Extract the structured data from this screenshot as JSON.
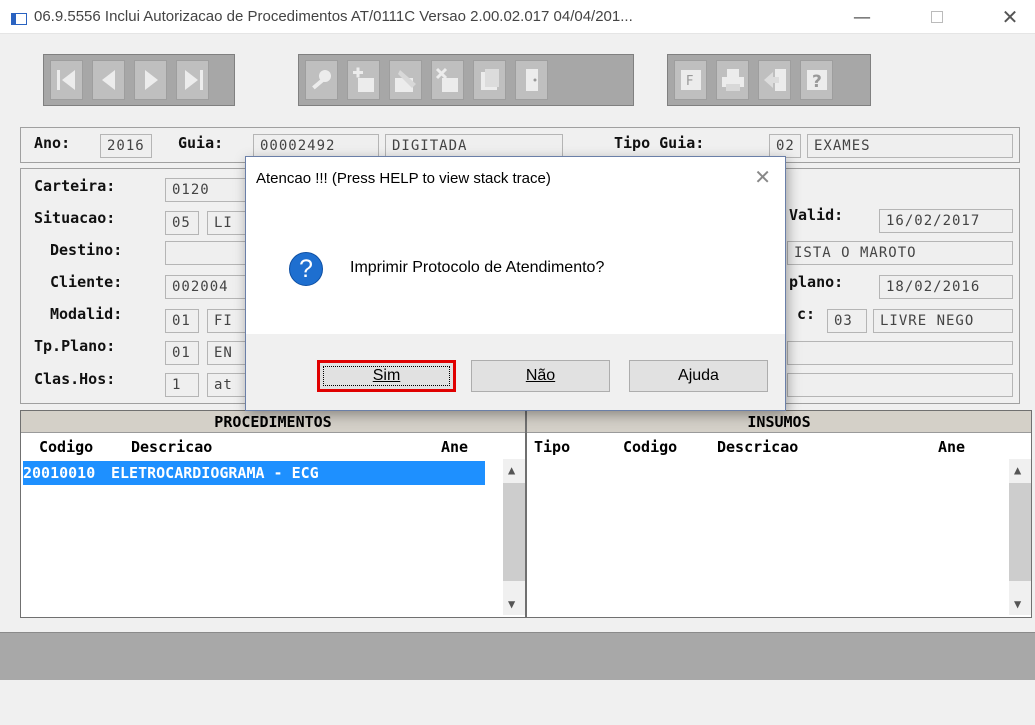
{
  "window": {
    "title": "06.9.5556   Inclui  Autorizacao de Procedimentos AT/0111C Versao 2.00.02.017 04/04/201..."
  },
  "header": {
    "ano_label": "Ano:",
    "ano_value": "2016",
    "guia_label": "Guia:",
    "guia_value": "00002492",
    "guia_status": "DIGITADA",
    "tipo_guia_label": "Tipo Guia:",
    "tipo_guia_code": "02",
    "tipo_guia_desc": "EXAMES"
  },
  "form": {
    "carteira_label": "Carteira:",
    "carteira_value": "0120",
    "situacao_label": "Situacao:",
    "situacao_code": "05",
    "situacao_desc": "LI",
    "destino_label": "Destino:",
    "cliente_label": "Cliente:",
    "cliente_value": "002004",
    "modalid_label": "Modalid:",
    "modalid_code": "01",
    "modalid_desc": "FI",
    "tp_plano_label": "Tp.Plano:",
    "tp_plano_code": "01",
    "tp_plano_desc": "EN",
    "clas_hos_label": "Clas.Hos:",
    "clas_hos_code": "1",
    "clas_hos_desc": "at",
    "valid_label": "Valid:",
    "valid_value": "16/02/2017",
    "destino_right": "ISTA O MAROTO",
    "plano_label": "plano:",
    "plano_value": "18/02/2016",
    "c_label": "c:",
    "c_code": "03",
    "c_desc": "LIVRE NEGO"
  },
  "procedimentos": {
    "title": "PROCEDIMENTOS",
    "columns": [
      "Codigo",
      "Descricao",
      "Ane"
    ],
    "rows": [
      {
        "codigo": "20010010",
        "descricao": "ELETROCARDIOGRAMA - ECG"
      }
    ]
  },
  "insumos": {
    "title": "INSUMOS",
    "columns": [
      "Tipo",
      "Codigo",
      "Descricao",
      "Ane"
    ]
  },
  "dialog": {
    "title": "Atencao !!!  (Press HELP to view stack trace)",
    "message": "Imprimir Protocolo de Atendimento?",
    "icon": "question-icon",
    "buttons": {
      "sim": "Sim",
      "nao": "Não",
      "ajuda": "Ajuda"
    }
  },
  "colors": {
    "selection": "#1e90ff",
    "highlight_border": "#e00000",
    "question_blue": "#1e6fd0"
  }
}
